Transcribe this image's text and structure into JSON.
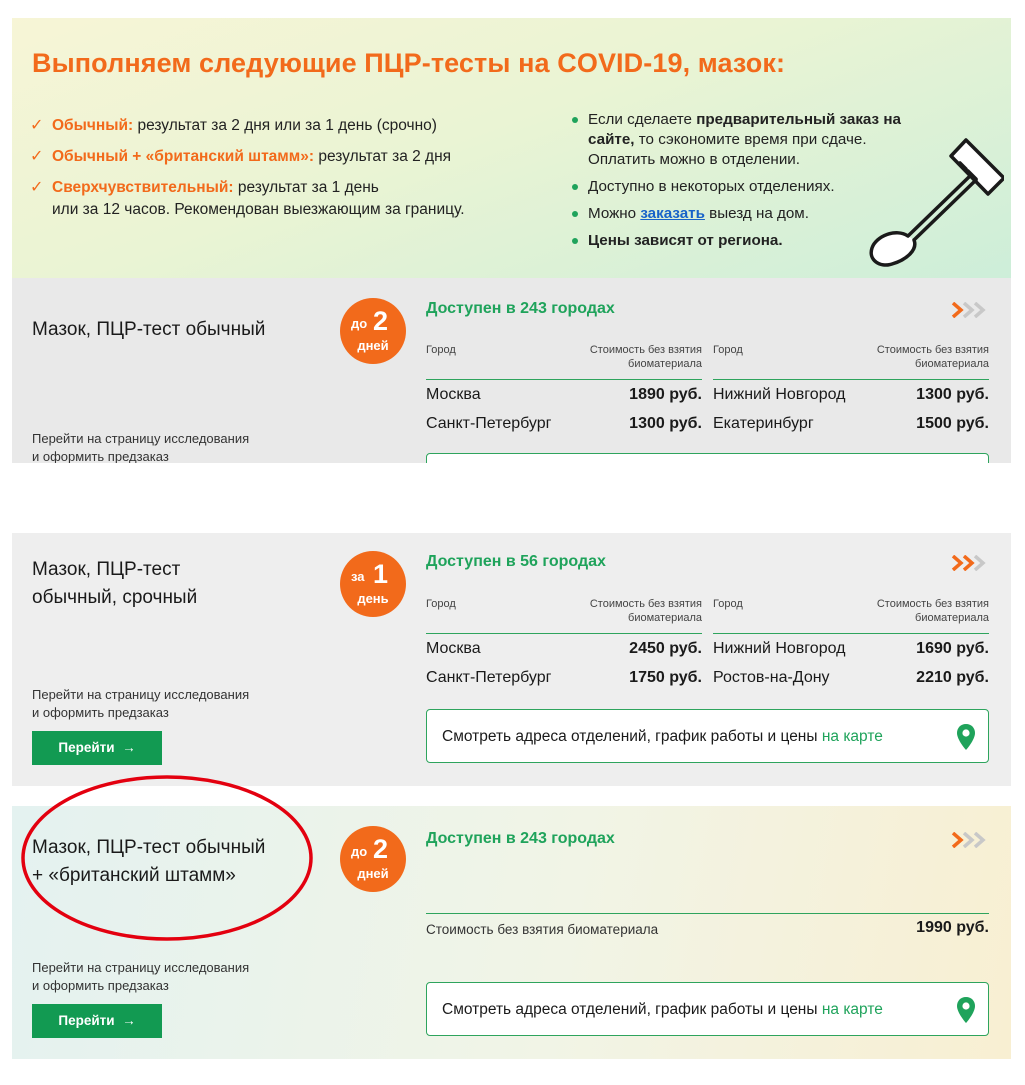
{
  "hero": {
    "title": "Выполняем следующие ПЦР-тесты на COVID-19, мазок:",
    "tests": [
      {
        "name": "Обычный:",
        "desc": "результат за 2 дня или за 1 день (срочно)"
      },
      {
        "name": "Обычный + «британский штамм»:",
        "desc": "результат за 2 дня"
      },
      {
        "name": "Сверхчувствительный:",
        "desc": "результат за 1 день",
        "desc2": "или за 12 часов. Рекомендован выезжающим за границу."
      }
    ],
    "notes": {
      "n1_pre": "Если сделаете ",
      "n1_bold": "предварительный заказ на сайте,",
      "n1_post": " то сэкономите время при сдаче. Оплатить можно в отделении.",
      "n2": "Доступно в некоторых отделениях.",
      "n3_pre": "Можно ",
      "n3_link": "заказать",
      "n3_post": " выезд на дом.",
      "n4": "Цены зависят от региона."
    },
    "swab_icon": "cotton-swab-icon"
  },
  "common": {
    "col_city": "Город",
    "col_price_l1": "Стоимость без взятия",
    "col_price_l2": "биоматериала",
    "goto_l1": "Перейти на страницу исследования",
    "goto_l2": "и оформить предзаказ",
    "goto_button": "Перейти",
    "map_text": "Смотреть адреса отделений, график работы и цены ",
    "map_link": "на карте",
    "accent": "#f26a1b",
    "green": "#1fa35b"
  },
  "cards": [
    {
      "title": "Мазок, ПЦР-тест обычный",
      "badge": {
        "pre": "до",
        "num": "2",
        "unit": "дней"
      },
      "availability": "Доступен в 243 городах",
      "rows": [
        {
          "c1": "Москва",
          "p1": "1890 руб.",
          "c2": "Нижний Новгород",
          "p2": "1300 руб."
        },
        {
          "c1": "Санкт-Петербург",
          "p1": "1300 руб.",
          "c2": "Екатеринбург",
          "p2": "1500 руб."
        }
      ]
    },
    {
      "title_l1": "Мазок, ПЦР-тест",
      "title_l2": "обычный, срочный",
      "badge": {
        "pre": "за",
        "num": "1",
        "unit": "день"
      },
      "availability": "Доступен в 56 городах",
      "rows": [
        {
          "c1": "Москва",
          "p1": "2450 руб.",
          "c2": "Нижний Новгород",
          "p2": "1690 руб."
        },
        {
          "c1": "Санкт-Петербург",
          "p1": "1750 руб.",
          "c2": "Ростов-на-Дону",
          "p2": "2210 руб."
        }
      ]
    },
    {
      "title_l1": "Мазок, ПЦР-тест обычный",
      "title_l2": "+ «британский штамм»",
      "badge": {
        "pre": "до",
        "num": "2",
        "unit": "дней"
      },
      "availability": "Доступен в 243 городах",
      "price_label": "Стоимость без взятия биоматериала",
      "price": "1990 руб."
    }
  ]
}
